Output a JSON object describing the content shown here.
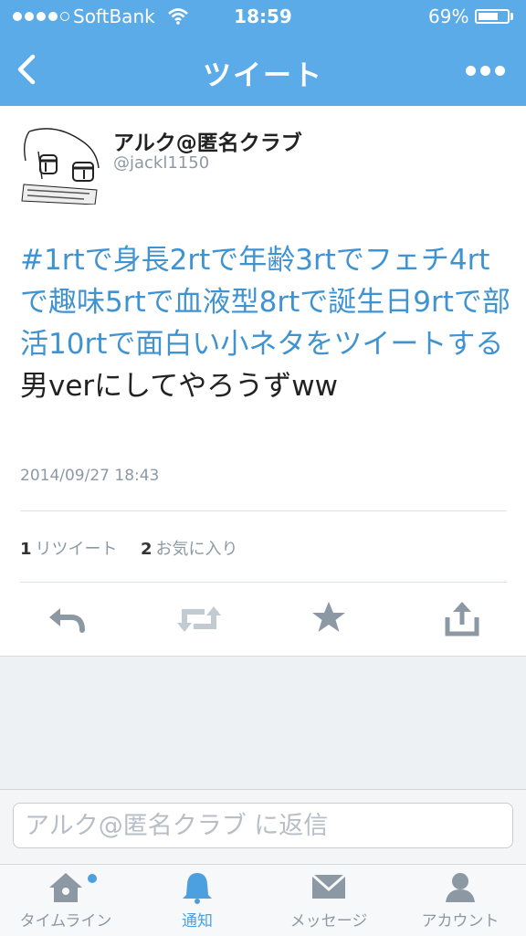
{
  "status_bar": {
    "carrier": "SoftBank",
    "time": "18:59",
    "battery_percent": "69%",
    "battery_level": 0.69,
    "signal_bars": 4
  },
  "nav": {
    "title": "ツイート",
    "back_icon": "chevron-left-icon",
    "more_icon": "more-dots-icon"
  },
  "tweet": {
    "author_name": "アルク@匿名クラブ",
    "handle": "@jackl1150",
    "hashtag_text": "#1rtで身長2rtで年齢3rtでフェチ4rtで趣味5rtで血液型8rtで誕生日9rtで部活10rtで面白い小ネタをツイートする",
    "body_text": "男verにしてやろうずww",
    "timestamp": "2014/09/27 18:43",
    "retweet_count": "1",
    "retweet_label": "リツイート",
    "favorite_count": "2",
    "favorite_label": "お気に入り"
  },
  "actions": {
    "reply_icon": "reply-icon",
    "retweet_icon": "retweet-icon",
    "favorite_icon": "star-icon",
    "share_icon": "share-icon"
  },
  "reply": {
    "placeholder": "アルク@匿名クラブ に返信"
  },
  "tabs": [
    {
      "label": "タイムライン",
      "icon": "home-icon"
    },
    {
      "label": "通知",
      "icon": "bell-icon"
    },
    {
      "label": "メッセージ",
      "icon": "envelope-icon"
    },
    {
      "label": "アカウント",
      "icon": "person-icon"
    }
  ],
  "colors": {
    "accent": "#5aabe8",
    "link": "#3f93d1",
    "active_tab": "#4da0e0",
    "muted": "#8c99a5"
  }
}
